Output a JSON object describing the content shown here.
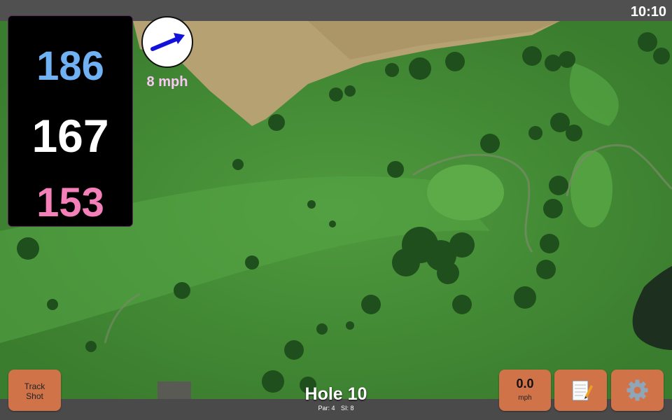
{
  "status_bar": {
    "clock": "10:10"
  },
  "distances": {
    "back": "186",
    "center": "167",
    "front": "153"
  },
  "wind": {
    "speed": "8 mph",
    "arrow_icon": "wind-arrow-icon"
  },
  "hole": {
    "title": "Hole 10",
    "par": "Par: 4",
    "si": "SI: 8"
  },
  "buttons": {
    "track_line1": "Track",
    "track_line2": "Shot",
    "speed_value": "0.0",
    "speed_unit": "mph",
    "notes_icon": "scorecard-notes-icon",
    "settings_icon": "gear-icon"
  },
  "colors": {
    "back_distance": "#6fb1f3",
    "center_distance": "#ffffff",
    "front_distance": "#f47fb9",
    "button": "#d07348",
    "wind_text": "#f9c8f5"
  }
}
